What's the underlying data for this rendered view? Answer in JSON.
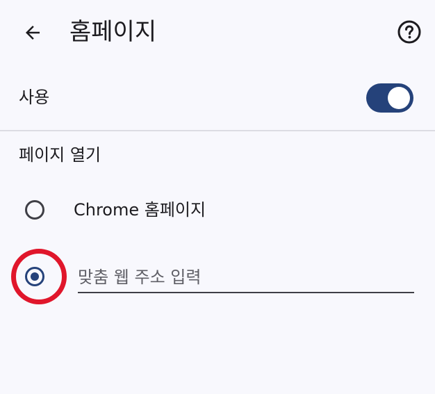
{
  "header": {
    "title": "홈페이지",
    "back_icon": "arrow-left-icon",
    "help_icon": "help-circle-icon"
  },
  "use_toggle": {
    "label": "사용",
    "state": "on",
    "accent": "#25427a"
  },
  "open_page": {
    "title": "페이지 열기",
    "options": [
      {
        "label": "Chrome 홈페이지",
        "selected": false
      },
      {
        "placeholder": "맞춤 웹 주소 입력",
        "value": "",
        "selected": true
      }
    ]
  },
  "highlight_color": "#e0162b"
}
